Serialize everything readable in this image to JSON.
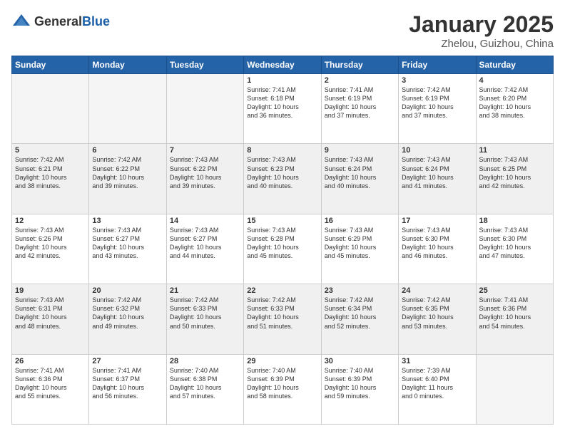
{
  "logo": {
    "general": "General",
    "blue": "Blue"
  },
  "header": {
    "month": "January 2025",
    "location": "Zhelou, Guizhou, China"
  },
  "weekdays": [
    "Sunday",
    "Monday",
    "Tuesday",
    "Wednesday",
    "Thursday",
    "Friday",
    "Saturday"
  ],
  "weeks": [
    [
      {
        "day": "",
        "info": ""
      },
      {
        "day": "",
        "info": ""
      },
      {
        "day": "",
        "info": ""
      },
      {
        "day": "1",
        "info": "Sunrise: 7:41 AM\nSunset: 6:18 PM\nDaylight: 10 hours\nand 36 minutes."
      },
      {
        "day": "2",
        "info": "Sunrise: 7:41 AM\nSunset: 6:19 PM\nDaylight: 10 hours\nand 37 minutes."
      },
      {
        "day": "3",
        "info": "Sunrise: 7:42 AM\nSunset: 6:19 PM\nDaylight: 10 hours\nand 37 minutes."
      },
      {
        "day": "4",
        "info": "Sunrise: 7:42 AM\nSunset: 6:20 PM\nDaylight: 10 hours\nand 38 minutes."
      }
    ],
    [
      {
        "day": "5",
        "info": "Sunrise: 7:42 AM\nSunset: 6:21 PM\nDaylight: 10 hours\nand 38 minutes."
      },
      {
        "day": "6",
        "info": "Sunrise: 7:42 AM\nSunset: 6:22 PM\nDaylight: 10 hours\nand 39 minutes."
      },
      {
        "day": "7",
        "info": "Sunrise: 7:43 AM\nSunset: 6:22 PM\nDaylight: 10 hours\nand 39 minutes."
      },
      {
        "day": "8",
        "info": "Sunrise: 7:43 AM\nSunset: 6:23 PM\nDaylight: 10 hours\nand 40 minutes."
      },
      {
        "day": "9",
        "info": "Sunrise: 7:43 AM\nSunset: 6:24 PM\nDaylight: 10 hours\nand 40 minutes."
      },
      {
        "day": "10",
        "info": "Sunrise: 7:43 AM\nSunset: 6:24 PM\nDaylight: 10 hours\nand 41 minutes."
      },
      {
        "day": "11",
        "info": "Sunrise: 7:43 AM\nSunset: 6:25 PM\nDaylight: 10 hours\nand 42 minutes."
      }
    ],
    [
      {
        "day": "12",
        "info": "Sunrise: 7:43 AM\nSunset: 6:26 PM\nDaylight: 10 hours\nand 42 minutes."
      },
      {
        "day": "13",
        "info": "Sunrise: 7:43 AM\nSunset: 6:27 PM\nDaylight: 10 hours\nand 43 minutes."
      },
      {
        "day": "14",
        "info": "Sunrise: 7:43 AM\nSunset: 6:27 PM\nDaylight: 10 hours\nand 44 minutes."
      },
      {
        "day": "15",
        "info": "Sunrise: 7:43 AM\nSunset: 6:28 PM\nDaylight: 10 hours\nand 45 minutes."
      },
      {
        "day": "16",
        "info": "Sunrise: 7:43 AM\nSunset: 6:29 PM\nDaylight: 10 hours\nand 45 minutes."
      },
      {
        "day": "17",
        "info": "Sunrise: 7:43 AM\nSunset: 6:30 PM\nDaylight: 10 hours\nand 46 minutes."
      },
      {
        "day": "18",
        "info": "Sunrise: 7:43 AM\nSunset: 6:30 PM\nDaylight: 10 hours\nand 47 minutes."
      }
    ],
    [
      {
        "day": "19",
        "info": "Sunrise: 7:43 AM\nSunset: 6:31 PM\nDaylight: 10 hours\nand 48 minutes."
      },
      {
        "day": "20",
        "info": "Sunrise: 7:42 AM\nSunset: 6:32 PM\nDaylight: 10 hours\nand 49 minutes."
      },
      {
        "day": "21",
        "info": "Sunrise: 7:42 AM\nSunset: 6:33 PM\nDaylight: 10 hours\nand 50 minutes."
      },
      {
        "day": "22",
        "info": "Sunrise: 7:42 AM\nSunset: 6:33 PM\nDaylight: 10 hours\nand 51 minutes."
      },
      {
        "day": "23",
        "info": "Sunrise: 7:42 AM\nSunset: 6:34 PM\nDaylight: 10 hours\nand 52 minutes."
      },
      {
        "day": "24",
        "info": "Sunrise: 7:42 AM\nSunset: 6:35 PM\nDaylight: 10 hours\nand 53 minutes."
      },
      {
        "day": "25",
        "info": "Sunrise: 7:41 AM\nSunset: 6:36 PM\nDaylight: 10 hours\nand 54 minutes."
      }
    ],
    [
      {
        "day": "26",
        "info": "Sunrise: 7:41 AM\nSunset: 6:36 PM\nDaylight: 10 hours\nand 55 minutes."
      },
      {
        "day": "27",
        "info": "Sunrise: 7:41 AM\nSunset: 6:37 PM\nDaylight: 10 hours\nand 56 minutes."
      },
      {
        "day": "28",
        "info": "Sunrise: 7:40 AM\nSunset: 6:38 PM\nDaylight: 10 hours\nand 57 minutes."
      },
      {
        "day": "29",
        "info": "Sunrise: 7:40 AM\nSunset: 6:39 PM\nDaylight: 10 hours\nand 58 minutes."
      },
      {
        "day": "30",
        "info": "Sunrise: 7:40 AM\nSunset: 6:39 PM\nDaylight: 10 hours\nand 59 minutes."
      },
      {
        "day": "31",
        "info": "Sunrise: 7:39 AM\nSunset: 6:40 PM\nDaylight: 11 hours\nand 0 minutes."
      },
      {
        "day": "",
        "info": ""
      }
    ]
  ]
}
